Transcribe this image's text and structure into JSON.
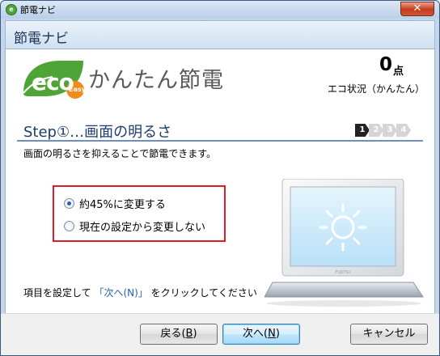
{
  "window": {
    "title": "節電ナビ",
    "close_symbol": "✕"
  },
  "header": {
    "title": "節電ナビ"
  },
  "logo": {
    "eco": "eco",
    "easy": "Easy",
    "mode_title": "かんたん節電"
  },
  "score": {
    "value": "0",
    "unit": "点",
    "caption": "エコ状況（かんたん）"
  },
  "step": {
    "title": "Step①…画面の明るさ",
    "indicator": [
      "1",
      "2",
      "3",
      "4"
    ],
    "active_index": 0,
    "description": "画面の明るさを抑えることで節電できます。"
  },
  "options": [
    {
      "label": "約45%に変更する",
      "checked": true
    },
    {
      "label": "現在の設定から変更しない",
      "checked": false
    }
  ],
  "instruction": {
    "prefix": "項目を設定して",
    "link": "「次へ(N)」",
    "suffix": "をクリックしてください"
  },
  "buttons": {
    "back": {
      "text": "戻る(",
      "mnemonic": "B",
      "close": ")"
    },
    "next": {
      "text": "次へ(",
      "mnemonic": "N",
      "close": ")"
    },
    "cancel": "キャンセル"
  },
  "colors": {
    "eco_green": "#4ea436",
    "step_active": "#222222",
    "highlight_border": "#e01b24",
    "link_blue": "#2a5fb4"
  },
  "icons": {
    "app": "eco-app-icon",
    "sun": "sun-icon",
    "laptop": "laptop-illustration"
  }
}
